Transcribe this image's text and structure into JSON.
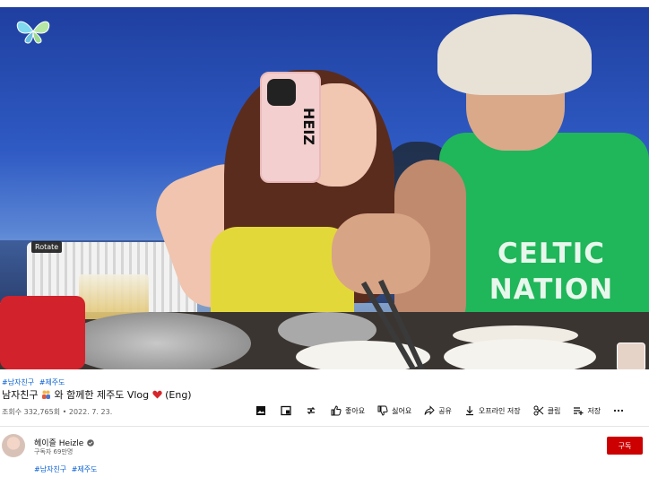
{
  "player": {
    "tooltip": "Rotate",
    "shirt_line1": "CELTIC",
    "shirt_line2": "NATION",
    "phone_text": "HEIZ"
  },
  "video": {
    "hashtags_top": [
      "#남자친구",
      "#제주도"
    ],
    "title_part1": "남자친구",
    "title_part2": "와 함께한 제주도 Vlog",
    "title_part3": " (Eng)",
    "views": "조회수 332,765회",
    "date": "2022. 7. 23."
  },
  "actions": {
    "like": "좋아요",
    "dislike": "싫어요",
    "share": "공유",
    "offline_save": "오프라인 저장",
    "clip": "클립",
    "save": "저장"
  },
  "channel": {
    "name": "헤이즐 Heizle",
    "subscribers": "구독자 69만명",
    "subscribe_label": "구독"
  },
  "hashtags_bottom": [
    "#남자친구",
    "#제주도"
  ]
}
